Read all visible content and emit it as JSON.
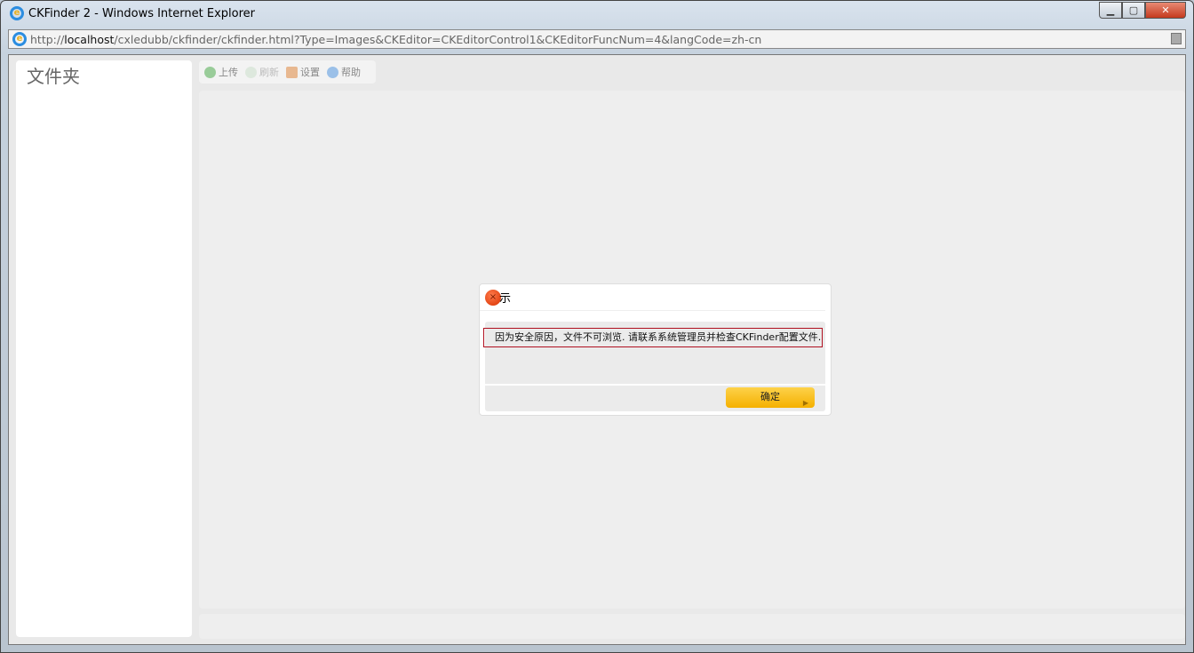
{
  "window": {
    "title": "CKFinder 2 - Windows Internet Explorer",
    "minimize": "▁",
    "maximize": "▢",
    "close": "✕"
  },
  "address": {
    "prefix": "http://",
    "host": "localhost",
    "path": "/cxledubb/ckfinder/ckfinder.html?Type=Images&CKEditor=CKEditorControl1&CKEditorFuncNum=4&langCode=zh-cn"
  },
  "sidebar": {
    "title": "文件夹"
  },
  "toolbar": {
    "upload": "上传",
    "refresh": "刷新",
    "settings": "设置",
    "help": "帮助"
  },
  "dialog": {
    "title": "示",
    "message": "因为安全原因，文件不可浏览. 请联系系统管理员并检查CKFinder配置文件.",
    "ok": "确定"
  }
}
